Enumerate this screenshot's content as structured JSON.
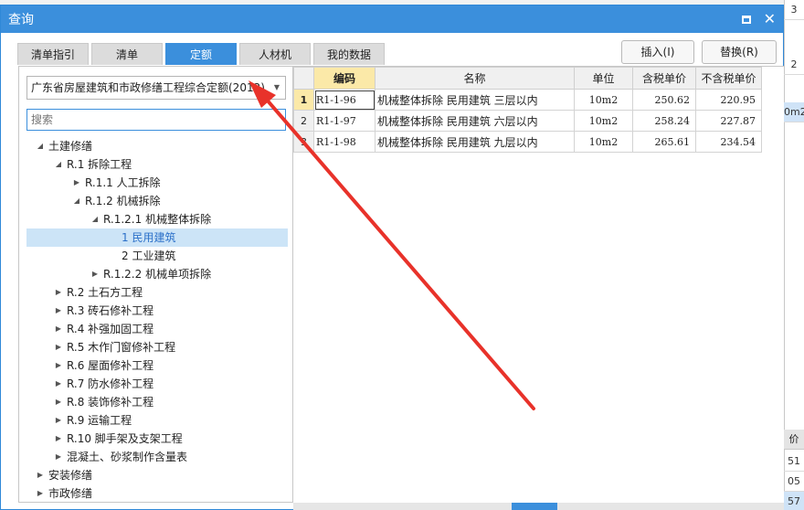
{
  "background": {
    "right_cells": [
      "3",
      "2",
      "0m2"
    ],
    "bottom_header": "价",
    "bottom_cells": [
      "51",
      "05",
      "57"
    ]
  },
  "dialog": {
    "title": "查询",
    "maximize_icon": "maximize-icon",
    "close_glyph": "✕"
  },
  "tabs": [
    {
      "label": "清单指引",
      "active": false
    },
    {
      "label": "清单",
      "active": false
    },
    {
      "label": "定额",
      "active": true
    },
    {
      "label": "人材机",
      "active": false
    },
    {
      "label": "我的数据",
      "active": false
    }
  ],
  "buttons": {
    "insert": "插入(I)",
    "replace": "替换(R)"
  },
  "library_select": {
    "value": "广东省房屋建筑和市政修缮工程综合定额(2012)"
  },
  "search": {
    "placeholder": "搜索"
  },
  "tree": [
    {
      "label": "土建修缮",
      "level": 0,
      "expanded": true,
      "has_children": true
    },
    {
      "label": "R.1 拆除工程",
      "level": 1,
      "expanded": true,
      "has_children": true
    },
    {
      "label": "R.1.1 人工拆除",
      "level": 2,
      "expanded": false,
      "has_children": true
    },
    {
      "label": "R.1.2 机械拆除",
      "level": 2,
      "expanded": true,
      "has_children": true
    },
    {
      "label": "R.1.2.1 机械整体拆除",
      "level": 3,
      "expanded": true,
      "has_children": true
    },
    {
      "label": "1 民用建筑",
      "level": 4,
      "expanded": false,
      "has_children": false,
      "selected": true
    },
    {
      "label": "2 工业建筑",
      "level": 4,
      "expanded": false,
      "has_children": false
    },
    {
      "label": "R.1.2.2 机械单项拆除",
      "level": 3,
      "expanded": false,
      "has_children": true
    },
    {
      "label": "R.2 土石方工程",
      "level": 1,
      "expanded": false,
      "has_children": true
    },
    {
      "label": "R.3 砖石修补工程",
      "level": 1,
      "expanded": false,
      "has_children": true
    },
    {
      "label": "R.4 补强加固工程",
      "level": 1,
      "expanded": false,
      "has_children": true
    },
    {
      "label": "R.5 木作门窗修补工程",
      "level": 1,
      "expanded": false,
      "has_children": true
    },
    {
      "label": "R.6 屋面修补工程",
      "level": 1,
      "expanded": false,
      "has_children": true
    },
    {
      "label": "R.7 防水修补工程",
      "level": 1,
      "expanded": false,
      "has_children": true
    },
    {
      "label": "R.8 装饰修补工程",
      "level": 1,
      "expanded": false,
      "has_children": true
    },
    {
      "label": "R.9 运输工程",
      "level": 1,
      "expanded": false,
      "has_children": true
    },
    {
      "label": "R.10 脚手架及支架工程",
      "level": 1,
      "expanded": false,
      "has_children": true
    },
    {
      "label": "混凝土、砂浆制作含量表",
      "level": 1,
      "expanded": false,
      "has_children": true
    },
    {
      "label": "安装修缮",
      "level": 0,
      "expanded": false,
      "has_children": true
    },
    {
      "label": "市政修缮",
      "level": 0,
      "expanded": false,
      "has_children": true
    }
  ],
  "grid": {
    "columns": [
      "编码",
      "名称",
      "单位",
      "含税单价",
      "不含税单价"
    ],
    "rows": [
      {
        "num": "1",
        "code": "R1-1-96",
        "name": "机械整体拆除 民用建筑 三层以内",
        "unit": "10m2",
        "price_tax": "250.62",
        "price_notax": "220.95"
      },
      {
        "num": "2",
        "code": "R1-1-97",
        "name": "机械整体拆除 民用建筑 六层以内",
        "unit": "10m2",
        "price_tax": "258.24",
        "price_notax": "227.87"
      },
      {
        "num": "3",
        "code": "R1-1-98",
        "name": "机械整体拆除 民用建筑 九层以内",
        "unit": "10m2",
        "price_tax": "265.61",
        "price_notax": "234.54"
      }
    ]
  },
  "annotation": {
    "color": "#e8322a"
  }
}
